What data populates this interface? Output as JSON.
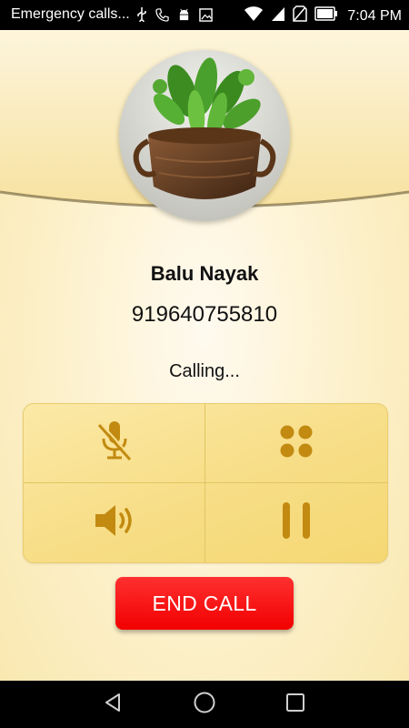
{
  "status_bar": {
    "title": "Emergency calls...",
    "time": "7:04 PM",
    "icons_left": [
      "usb-icon",
      "phone-icon",
      "android-icon",
      "image-icon"
    ],
    "icons_right": [
      "wifi-icon",
      "sim-signal-icon",
      "no-sim-icon",
      "battery-icon"
    ]
  },
  "contact": {
    "name": "Balu Nayak",
    "number": "919640755810"
  },
  "call": {
    "status": "Calling..."
  },
  "controls": {
    "mute": "mic-off-icon",
    "dialpad": "dialpad-icon",
    "speaker": "speaker-icon",
    "hold": "pause-icon"
  },
  "end_call": {
    "label": "END CALL"
  },
  "nav": [
    "back-icon",
    "home-icon",
    "recents-icon"
  ],
  "colors": {
    "accent_icon": "#c28a10",
    "end_call": "#ff1a1a",
    "panel": "#f8e08f"
  }
}
